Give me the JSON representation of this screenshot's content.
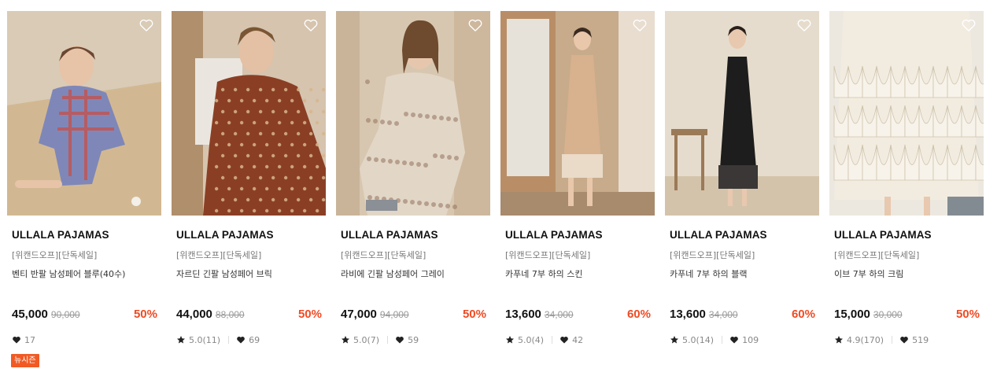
{
  "products": [
    {
      "brand": "ULLALA PAJAMAS",
      "tag": "[위캔드오프][단독세일]",
      "name": "벤티 반팔 남성페어 블루(40수)",
      "price": "45,000",
      "original_price": "90,000",
      "discount": "50%",
      "rating": "",
      "likes": "17",
      "badge": "뉴시즌",
      "image": {
        "subject": "man-plaid-short-sleeve-pajamas",
        "bg": "#d9cbb6",
        "fill": "#7f87b8",
        "accent": "#c4524e",
        "skin": "#e7c4a8",
        "hair": "#6b4630"
      }
    },
    {
      "brand": "ULLALA PAJAMAS",
      "tag": "[위캔드오프][단독세일]",
      "name": "자르딘 긴팔 남성페어 브릭",
      "price": "44,000",
      "original_price": "88,000",
      "discount": "50%",
      "rating": "5.0(11)",
      "likes": "69",
      "badge": "",
      "image": {
        "subject": "man-brick-pattern-pajamas",
        "bg": "#d6c4ae",
        "fill": "#8a3f25",
        "accent": "#d7b58c",
        "skin": "#e4c0a4",
        "hair": "#7a5634"
      }
    },
    {
      "brand": "ULLALA PAJAMAS",
      "tag": "[위캔드오프][단독세일]",
      "name": "라비에 긴팔 남성페어 그레이",
      "price": "47,000",
      "original_price": "94,000",
      "discount": "50%",
      "rating": "5.0(7)",
      "likes": "59",
      "badge": "",
      "image": {
        "subject": "man-floral-grey-pajamas",
        "bg": "#d8c7b0",
        "fill": "#e2d6c6",
        "accent": "#9a7a66",
        "skin": "#e6c7ae",
        "hair": "#6e4a2e"
      }
    },
    {
      "brand": "ULLALA PAJAMAS",
      "tag": "[위캔드오프][단독세일]",
      "name": "카푸네 7부 하의 스킨",
      "price": "13,600",
      "original_price": "34,000",
      "discount": "60%",
      "rating": "5.0(4)",
      "likes": "42",
      "badge": "",
      "image": {
        "subject": "woman-skin-slip-dress",
        "bg": "#c7ab8a",
        "fill": "#d8b18e",
        "accent": "#efe3d2",
        "skin": "#e8c7aa",
        "hair": "#3a2a20"
      }
    },
    {
      "brand": "ULLALA PAJAMAS",
      "tag": "[위캔드오프][단독세일]",
      "name": "카푸네 7부 하의 블랙",
      "price": "13,600",
      "original_price": "34,000",
      "discount": "60%",
      "rating": "5.0(14)",
      "likes": "109",
      "badge": "",
      "image": {
        "subject": "woman-black-slip-dress",
        "bg": "#e6dccd",
        "fill": "#1e1d1d",
        "accent": "#9b7a57",
        "skin": "#e8c8ae",
        "hair": "#2a1f1a"
      }
    },
    {
      "brand": "ULLALA PAJAMAS",
      "tag": "[위캔드오프][단독세일]",
      "name": "이브 7부 하의 크림",
      "price": "15,000",
      "original_price": "30,000",
      "discount": "50%",
      "rating": "4.9(170)",
      "likes": "519",
      "badge": "",
      "image": {
        "subject": "cream-ruffle-pants",
        "bg": "#ddd7cc",
        "fill": "#f2ece0",
        "accent": "#cfc3ad",
        "skin": "#e8c8ae",
        "hair": "#2a1f1a"
      }
    }
  ],
  "icons": {
    "wishlist": "heart-outline-icon",
    "like": "heart-filled-icon",
    "rating": "star-icon"
  },
  "colors": {
    "discount": "#f04a23",
    "badge_bg": "#f15a24",
    "strike_price": "#999999",
    "meta_text": "#888888"
  }
}
